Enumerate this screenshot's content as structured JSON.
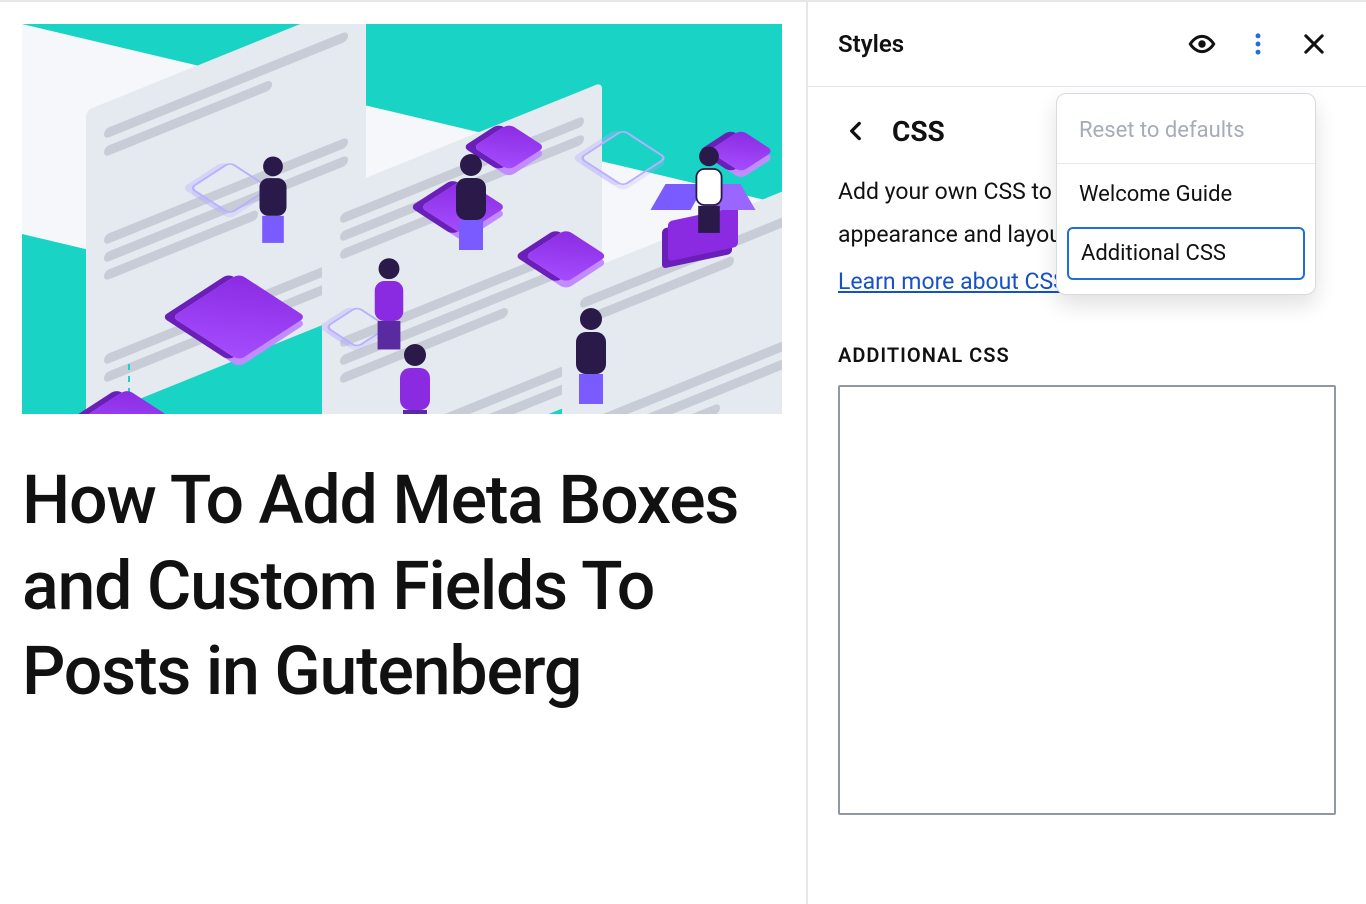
{
  "canvas": {
    "post_title": "How To Add Meta Boxes and Custom Fields To Posts in Gutenberg"
  },
  "sidebar": {
    "header_title": "Styles",
    "section_title": "CSS",
    "description": "Add your own CSS to customize the appearance and layout of your site.",
    "learn_more": "Learn more about CSS",
    "additional_label": "ADDITIONAL CSS",
    "textarea_value": ""
  },
  "dropdown": {
    "reset": "Reset to defaults",
    "welcome": "Welcome Guide",
    "additional": "Additional CSS"
  },
  "icons": {
    "eye": "eye-icon",
    "kebab": "kebab-icon",
    "close": "close-icon",
    "back": "chevron-left-icon"
  },
  "colors": {
    "accent": "#1e6fd9",
    "teal": "#19d3c5",
    "purple": "#8a2be2"
  }
}
